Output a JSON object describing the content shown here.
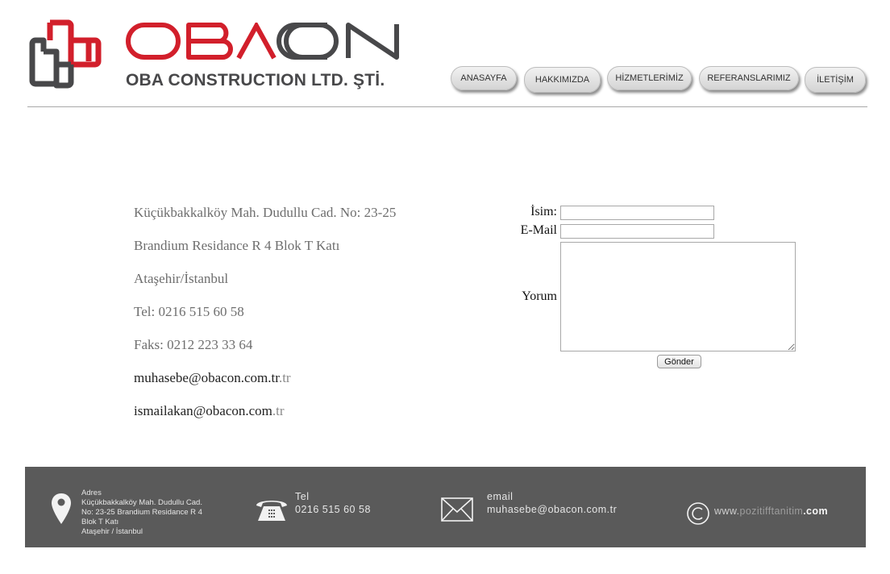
{
  "header": {
    "brand": "OBACON",
    "subtitle": "OBA CONSTRUCTION LTD. ŞTİ.",
    "colors": {
      "brand_red": "#d21f2b",
      "brand_gray": "#48484a"
    }
  },
  "nav": {
    "items": [
      "ANASAYFA",
      "HAKKIMIZDA",
      "HİZMETLERİMİZ",
      "REFERANSLARIMIZ",
      "İLETİŞİM"
    ]
  },
  "address": {
    "line1": "Küçükbakkalköy Mah. Dudullu Cad. No: 23-25",
    "line2": "Brandium Residance R 4 Blok T Katı",
    "line3": "Ataşehir/İstanbul",
    "tel": "Tel: 0216 515 60 58",
    "fax": "Faks: 0212 223 33 64",
    "email1": "muhasebe@obacon.com.tr",
    "email1_suffix": ".tr",
    "email2": "ismailakan@obacon.com",
    "email2_suffix": ".tr"
  },
  "form": {
    "name_label": "İsim:",
    "email_label": "E-Mail",
    "comment_label": "Yorum",
    "name_value": "",
    "email_value": "",
    "comment_value": "",
    "submit_label": "Gönder"
  },
  "footer": {
    "address_title": "Adres",
    "address_lines": [
      "Küçükbakkalköy Mah. Dudullu Cad.",
      "No: 23-25 Brandium Residance R 4",
      "Blok T Katı",
      "Ataşehir / İstanbul"
    ],
    "tel_title": "Tel",
    "tel_value": "0216 515 60 58",
    "email_title": "email",
    "email_value": "muhasebe@obacon.com.tr",
    "credit_prefix": "www.",
    "credit_name": "pozitifftanitim",
    "credit_suffix": ".com",
    "colors": {
      "bg": "#5a5a5a"
    }
  }
}
